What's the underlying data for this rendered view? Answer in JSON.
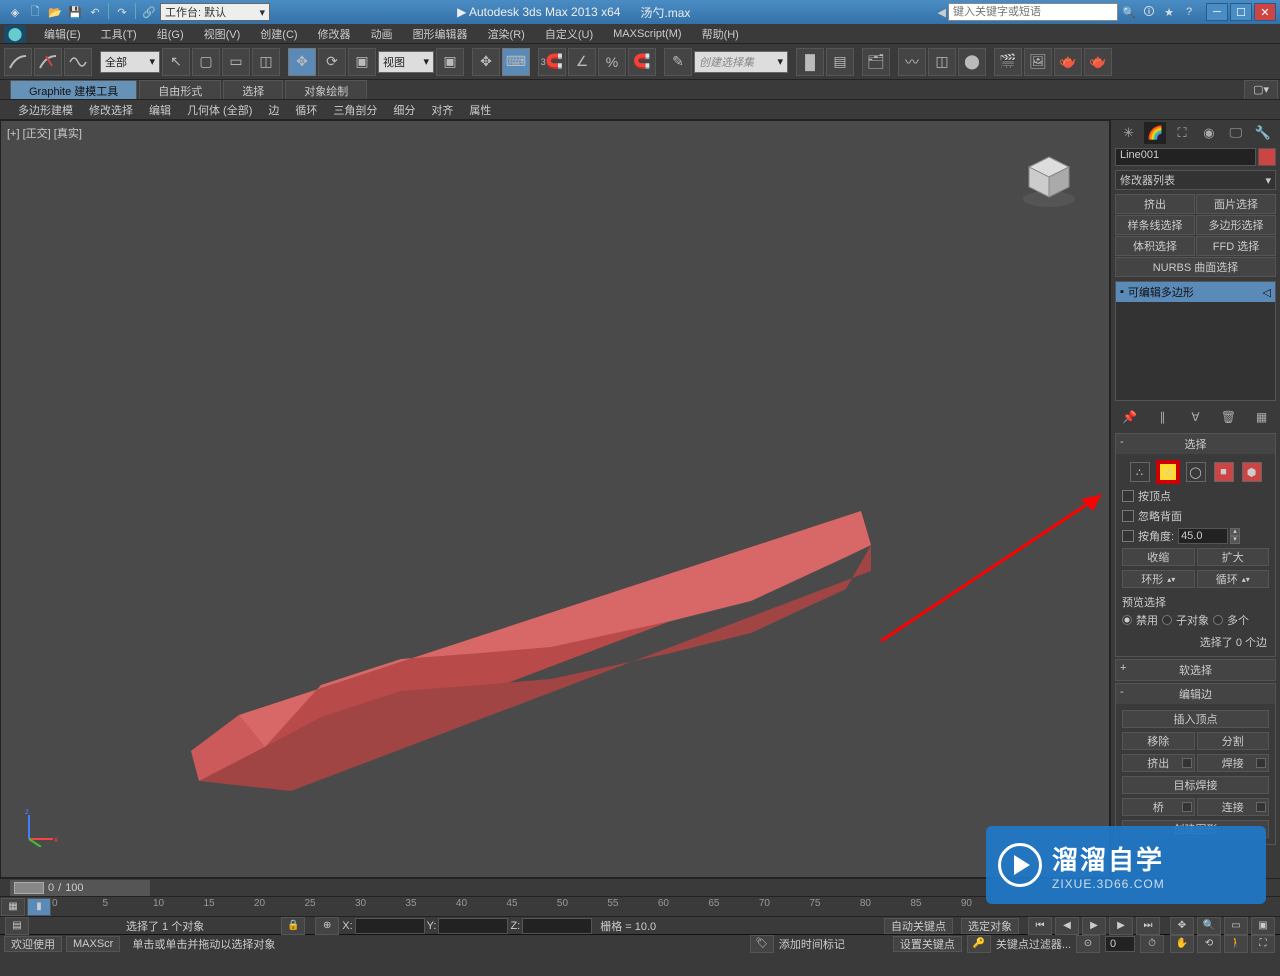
{
  "titlebar": {
    "workspace_prefix": "工作台:",
    "workspace_value": "默认",
    "app_title": "Autodesk 3ds Max  2013 x64",
    "doc_title": "汤勺.max",
    "search_placeholder": "键入关键字或短语"
  },
  "menu": {
    "items": [
      "编辑(E)",
      "工具(T)",
      "组(G)",
      "视图(V)",
      "创建(C)",
      "修改器",
      "动画",
      "图形编辑器",
      "渲染(R)",
      "自定义(U)",
      "MAXScript(M)",
      "帮助(H)"
    ]
  },
  "toolbar": {
    "sel_filter": "全部",
    "ref_coord": "视图",
    "named_sel": "创建选择集"
  },
  "ribbon": {
    "tabs": [
      "Graphite 建模工具",
      "自由形式",
      "选择",
      "对象绘制"
    ],
    "sub": [
      "多边形建模",
      "修改选择",
      "编辑",
      "几何体 (全部)",
      "边",
      "循环",
      "三角剖分",
      "细分",
      "对齐",
      "属性"
    ]
  },
  "viewport": {
    "label": "[+] [正交] [真实]"
  },
  "command_panel": {
    "obj_name": "Line001",
    "modifier_list": "修改器列表",
    "quick_mods": [
      "挤出",
      "面片选择",
      "样条线选择",
      "多边形选择",
      "体积选择",
      "FFD 选择"
    ],
    "nurbs_btn": "NURBS 曲面选择",
    "stack_item": "可编辑多边形",
    "selection": {
      "title": "选择",
      "by_vertex": "按顶点",
      "ignore_back": "忽略背面",
      "by_angle": "按角度:",
      "angle_val": "45.0",
      "shrink": "收缩",
      "grow": "扩大",
      "ring": "环形",
      "loop": "循环",
      "preview_label": "预览选择",
      "preview_off": "禁用",
      "preview_subobj": "子对象",
      "preview_multi": "多个",
      "sel_info": "选择了 0 个边"
    },
    "soft_sel": {
      "title": "软选择"
    },
    "edit_edges": {
      "title": "编辑边",
      "insert_vert": "插入顶点",
      "remove": "移除",
      "split": "分割",
      "extrude": "挤出",
      "weld": "焊接",
      "target_weld": "目标焊接",
      "bridge": "桥",
      "connect": "连接",
      "create_shape": "创建图形"
    }
  },
  "timeline": {
    "current": "0",
    "total": "100",
    "ticks": [
      "0",
      "5",
      "10",
      "15",
      "20",
      "25",
      "30",
      "35",
      "40",
      "45",
      "50",
      "55",
      "60",
      "65",
      "70",
      "75",
      "80",
      "85",
      "90"
    ]
  },
  "status": {
    "sel_msg": "选择了 1 个对象",
    "hint": "单击或单击并拖动以选择对象",
    "x_label": "X:",
    "y_label": "Y:",
    "z_label": "Z:",
    "grid": "栅格 = 10.0",
    "auto_key": "自动关键点",
    "selected_only": "选定对象",
    "add_time_tag": "添加时间标记",
    "set_key": "设置关键点",
    "key_filters": "关键点过滤器...",
    "welcome": "欢迎使用",
    "maxscr": "MAXScr"
  },
  "watermark": {
    "big": "溜溜自学",
    "small": "ZIXUE.3D66.COM"
  }
}
